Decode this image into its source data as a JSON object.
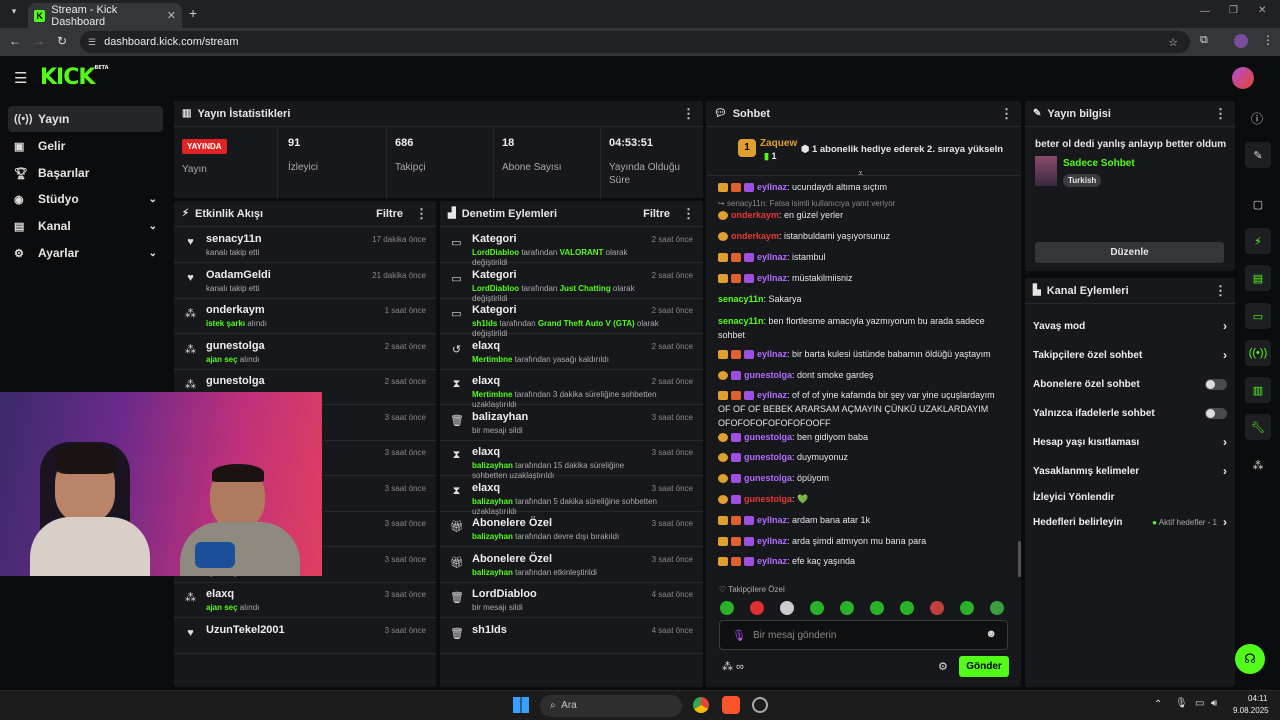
{
  "browser": {
    "tab_title": "Stream - Kick Dashboard",
    "url": "dashboard.kick.com/stream"
  },
  "kick": {
    "logo": "KICK",
    "beta": "BETA"
  },
  "sidebar": {
    "items": [
      {
        "label": "Yayın",
        "icon": "broadcast-icon"
      },
      {
        "label": "Gelir",
        "icon": "revenue-icon"
      },
      {
        "label": "Başarılar",
        "icon": "trophy-icon"
      },
      {
        "label": "Stüdyo",
        "icon": "studio-icon"
      },
      {
        "label": "Kanal",
        "icon": "channel-icon"
      },
      {
        "label": "Ayarlar",
        "icon": "gear-icon"
      }
    ]
  },
  "stats": {
    "title": "Yayın İstatistikleri",
    "live_badge": "YAYINDA",
    "live_label": "Yayın",
    "viewers": "91",
    "viewers_label": "İzleyici",
    "followers": "686",
    "followers_label": "Takipçi",
    "subs": "18",
    "subs_label": "Abone Sayısı",
    "duration": "04:53:51",
    "duration_label": "Yayında Olduğu Süre"
  },
  "activity": {
    "title": "Etkinlik Akışı",
    "filter": "Filtre",
    "rows": [
      {
        "name": "senacy11n",
        "desc": "kanalı takip etti",
        "time": "17 dakika önce"
      },
      {
        "name": "OadamGeldi",
        "desc": "kanalı takip etti",
        "time": "21 dakika önce"
      },
      {
        "name": "onderkaym",
        "hl": "istek şarkı",
        "desc": " alındı",
        "time": "1 saat önce"
      },
      {
        "name": "gunestolga",
        "hl": "ajan seç",
        "desc": " alındı",
        "time": "2 saat önce"
      },
      {
        "name": "gunestolga",
        "hl": "",
        "desc": "",
        "time": "2 saat önce"
      },
      {
        "name": "",
        "hl": "",
        "desc": "",
        "time": "3 saat önce"
      },
      {
        "name": "",
        "hl": "",
        "desc": "",
        "time": "3 saat önce"
      },
      {
        "name": "",
        "hl": "",
        "desc": "",
        "time": "3 saat önce"
      },
      {
        "name": "",
        "hl": "ajan seç",
        "desc": " alındı",
        "time": "3 saat önce"
      },
      {
        "name": "elaxq",
        "hl": "ajan seç",
        "desc": " alındı",
        "time": "3 saat önce"
      },
      {
        "name": "elaxq",
        "hl": "ajan seç",
        "desc": " alındı",
        "time": "3 saat önce"
      },
      {
        "name": "UzunTekel2001",
        "hl": "",
        "desc": "",
        "time": "3 saat önce"
      }
    ]
  },
  "moderation": {
    "title": "Denetim Eylemleri",
    "filter": "Filtre",
    "rows": [
      {
        "title": "Kategori",
        "who": "LordDiabloo",
        "mid": " tarafından ",
        "hl": "VALORANT",
        "end": " olarak değiştirildi",
        "time": "2 saat önce"
      },
      {
        "title": "Kategori",
        "who": "LordDiabloo",
        "mid": " tarafından ",
        "hl": "Just Chatting",
        "end": " olarak değiştirildi",
        "time": "2 saat önce"
      },
      {
        "title": "Kategori",
        "who": "sh1lds",
        "mid": " tarafından ",
        "hl": "Grand Theft Auto V (GTA)",
        "end": " olarak değiştirildi",
        "time": "2 saat önce"
      },
      {
        "title": "elaxq",
        "who": "Mertimbne",
        "mid": " tarafından yasağı kaldırıldı",
        "hl": "",
        "end": "",
        "time": "2 saat önce"
      },
      {
        "title": "elaxq",
        "who": "Mertimbne",
        "mid": " tarafından 3 dakika süreliğine sohbetten uzaklaştırıldı",
        "hl": "",
        "end": "",
        "time": "2 saat önce"
      },
      {
        "title": "balizayhan",
        "who": "",
        "mid": "bir mesajı sildi",
        "hl": "",
        "end": "",
        "time": "3 saat önce"
      },
      {
        "title": "elaxq",
        "who": "balizayhan",
        "mid": " tarafından 15 dakika süreliğine sohbetten uzaklaştırıldı",
        "hl": "",
        "end": "",
        "time": "3 saat önce"
      },
      {
        "title": "elaxq",
        "who": "balizayhan",
        "mid": " tarafından 5 dakika süreliğine sohbetten uzaklaştırıldı",
        "hl": "",
        "end": "",
        "time": "3 saat önce"
      },
      {
        "title": "Abonelere Özel",
        "who": "balizayhan",
        "mid": " tarafından devre dışı bırakıldı",
        "hl": "",
        "end": "",
        "time": "3 saat önce"
      },
      {
        "title": "Abonelere Özel",
        "who": "balizayhan",
        "mid": " tarafından etkinleştirildi",
        "hl": "",
        "end": "",
        "time": "3 saat önce"
      },
      {
        "title": "LordDiabloo",
        "who": "",
        "mid": "bir mesajı sildi",
        "hl": "",
        "end": "",
        "time": "4 saat önce"
      },
      {
        "title": "sh1lds",
        "who": "",
        "mid": "",
        "hl": "",
        "end": "",
        "time": "4 saat önce"
      }
    ]
  },
  "chat": {
    "title": "Sohbet",
    "pinned_user": "Zaquew",
    "pinned_count": "1",
    "pinned_msg": "1 abonelik hediye ederek 2. sıraya yükseln",
    "reply_hint": "senacy11n: Fatsa isimli kullanıcıya yanıt veriyor",
    "messages": [
      {
        "user": "eyllnaz",
        "color": "#b36bff",
        "text": ": ucundaydı altıma sıçtım",
        "crown": true
      },
      {
        "user": "onderkaym",
        "color": "#e53935",
        "text": ": en güzel yerler",
        "crown": false
      },
      {
        "user": "onderkaym",
        "color": "#e53935",
        "text": ": istanbuldami yaşıyorsunuz",
        "crown": false
      },
      {
        "user": "eyllnaz",
        "color": "#b36bff",
        "text": ": istambul",
        "crown": true
      },
      {
        "user": "eyllnaz",
        "color": "#b36bff",
        "text": ": müstakilmiisniz",
        "crown": true
      },
      {
        "user": "senacy11n",
        "color": "#53fc18",
        "text": ": Sakarya",
        "crown": false
      },
      {
        "user": "senacy11n",
        "color": "#53fc18",
        "text": ": ben flortlesme amacıyla yazmıyorum bu arada sadece sohbet",
        "crown": false
      },
      {
        "user": "eyllnaz",
        "color": "#b36bff",
        "text": ": bir barta kulesi üstünde babamın öldüğü yaştayım",
        "crown": true
      },
      {
        "user": "gunestolga",
        "color": "#b36bff",
        "text": ": dont smoke gardeş",
        "crown": false
      },
      {
        "user": "eyllnaz",
        "color": "#b36bff",
        "text": ": of of of yine kafamda bir şey var yine uçuşlardayım OF OF OF BEBEK ARARSAM AÇMAYIN ÇÜNKÜ UZAKLARDAYIM OFOFOFOFOFOFOFOOFF",
        "crown": true
      },
      {
        "user": "gunestolga",
        "color": "#b36bff",
        "text": ": ben gidiyom baba",
        "crown": false
      },
      {
        "user": "gunestolga",
        "color": "#b36bff",
        "text": ": duymuyonuz",
        "crown": false
      },
      {
        "user": "gunestolga",
        "color": "#b36bff",
        "text": ": öpüyom",
        "crown": false
      },
      {
        "user": "gunestolga",
        "color": "#e53935",
        "text": ": 💚",
        "crown": false
      },
      {
        "user": "eyllnaz",
        "color": "#b36bff",
        "text": ": ardam bana atar 1k",
        "crown": true
      },
      {
        "user": "eyllnaz",
        "color": "#b36bff",
        "text": ": arda şimdi atmıyon mu bana para",
        "crown": true
      },
      {
        "user": "eyllnaz",
        "color": "#b36bff",
        "text": ": efe kaç yaşında",
        "crown": true
      }
    ],
    "followers_only": "Takipçilere Özel",
    "input_placeholder": "Bir mesaj gönderin",
    "send": "Gönder"
  },
  "stream_info": {
    "title": "Yayın bilgisi",
    "stream_title": "beter ol dedi yanlış anlayıp better oldum",
    "category": "Sadece Sohbet",
    "tag": "Turkish",
    "edit": "Düzenle"
  },
  "channel_actions": {
    "title": "Kanal Eylemleri",
    "items": [
      {
        "label": "Yavaş mod",
        "kind": "chev"
      },
      {
        "label": "Takipçilere özel sohbet",
        "kind": "chev"
      },
      {
        "label": "Abonelere özel sohbet",
        "kind": "toggle"
      },
      {
        "label": "Yalnızca ifadelerle sohbet",
        "kind": "toggle"
      },
      {
        "label": "Hesap yaşı kısıtlaması",
        "kind": "chev"
      },
      {
        "label": "Yasaklanmış kelimeler",
        "kind": "chev"
      },
      {
        "label": "İzleyici Yönlendir",
        "kind": "none"
      },
      {
        "label": "Hedefleri belirleyin",
        "kind": "goal"
      }
    ],
    "goal_status": "Aktif hedefler - 1"
  },
  "taskbar": {
    "search": "Ara",
    "time": "04:11",
    "date": "9.08.2025"
  }
}
